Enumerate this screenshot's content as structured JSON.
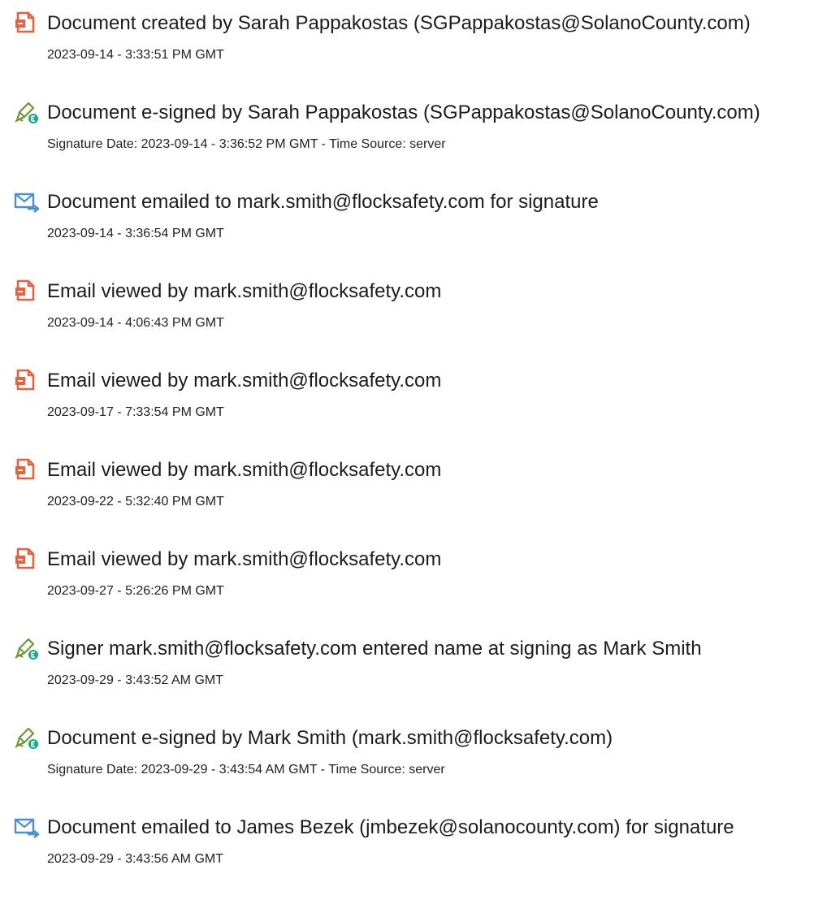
{
  "colors": {
    "doc_icon": "#e8613a",
    "sign_icon_pen": "#6a9a2e",
    "sign_icon_badge": "#17a88c",
    "mail_icon": "#4a8fd0",
    "text": "#1c1c1c"
  },
  "events": [
    {
      "icon": "document-icon",
      "title": "Document created by Sarah Pappakostas (SGPappakostas@SolanoCounty.com)",
      "detail": "2023-09-14 - 3:33:51 PM GMT"
    },
    {
      "icon": "esign-pen-icon",
      "title": "Document e-signed by Sarah Pappakostas (SGPappakostas@SolanoCounty.com)",
      "detail": "Signature Date: 2023-09-14 - 3:36:52 PM GMT - Time Source: server"
    },
    {
      "icon": "email-sent-icon",
      "title": "Document emailed to mark.smith@flocksafety.com for signature",
      "detail": "2023-09-14 - 3:36:54 PM GMT"
    },
    {
      "icon": "document-icon",
      "title": "Email viewed by mark.smith@flocksafety.com",
      "detail": "2023-09-14 - 4:06:43 PM GMT"
    },
    {
      "icon": "document-icon",
      "title": "Email viewed by mark.smith@flocksafety.com",
      "detail": "2023-09-17 - 7:33:54 PM GMT"
    },
    {
      "icon": "document-icon",
      "title": "Email viewed by mark.smith@flocksafety.com",
      "detail": "2023-09-22 - 5:32:40 PM GMT"
    },
    {
      "icon": "document-icon",
      "title": "Email viewed by mark.smith@flocksafety.com",
      "detail": "2023-09-27 - 5:26:26 PM GMT"
    },
    {
      "icon": "esign-pen-icon",
      "title": "Signer mark.smith@flocksafety.com entered name at signing as Mark Smith",
      "detail": "2023-09-29 - 3:43:52 AM GMT"
    },
    {
      "icon": "esign-pen-icon",
      "title": "Document e-signed by Mark Smith (mark.smith@flocksafety.com)",
      "detail": "Signature Date: 2023-09-29 - 3:43:54 AM GMT - Time Source: server"
    },
    {
      "icon": "email-sent-icon",
      "title": "Document emailed to James Bezek (jmbezek@solanocounty.com) for signature",
      "detail": "2023-09-29 - 3:43:56 AM GMT"
    }
  ]
}
